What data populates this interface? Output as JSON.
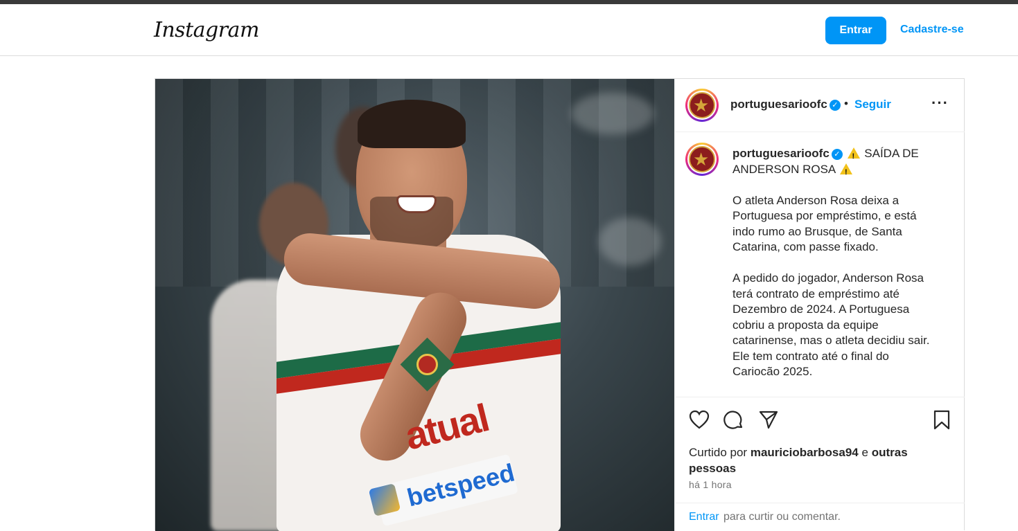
{
  "header": {
    "logo_text": "Instagram",
    "login_button": "Entrar",
    "signup_link": "Cadastre-se"
  },
  "post": {
    "username": "portuguesarioofc",
    "verified_icon": "✓",
    "dot_separator": "•",
    "follow_label": "Seguir",
    "more_icon": "···",
    "caption": {
      "title": "SAÍDA DE ANDERSON ROSA",
      "paragraph1": "O atleta Anderson Rosa deixa a\nPortuguesa por empréstimo, e está\nindo rumo ao Brusque, de Santa\nCatarina, com passe fixado.",
      "paragraph2": "A pedido do jogador, Anderson Rosa\nterá contrato de empréstimo até\nDezembro de 2024. A Portuguesa\ncobriu a proposta da equipe\ncatarinense, mas o atleta decidiu sair.\nEle tem contrato até o final do\nCariocão 2025."
    },
    "photo": {
      "sponsor_main": "atual",
      "sponsor_sub": "betspeed"
    },
    "likes": {
      "prefix": "Curtido por",
      "user": "mauriciobarbosa94",
      "connector": "e",
      "others": "outras pessoas"
    },
    "time": "há 1 hora",
    "footer": {
      "login_link": "Entrar",
      "rest": "para curtir ou comentar."
    }
  },
  "icons": {
    "like": "heart-icon",
    "comment": "comment-icon",
    "share": "share-icon",
    "save": "bookmark-icon",
    "warning": "warning-icon",
    "verified": "verified-icon"
  },
  "colors": {
    "accent": "#0095f6",
    "text": "#262626",
    "muted": "#737373",
    "warning": "#f2c21b"
  }
}
